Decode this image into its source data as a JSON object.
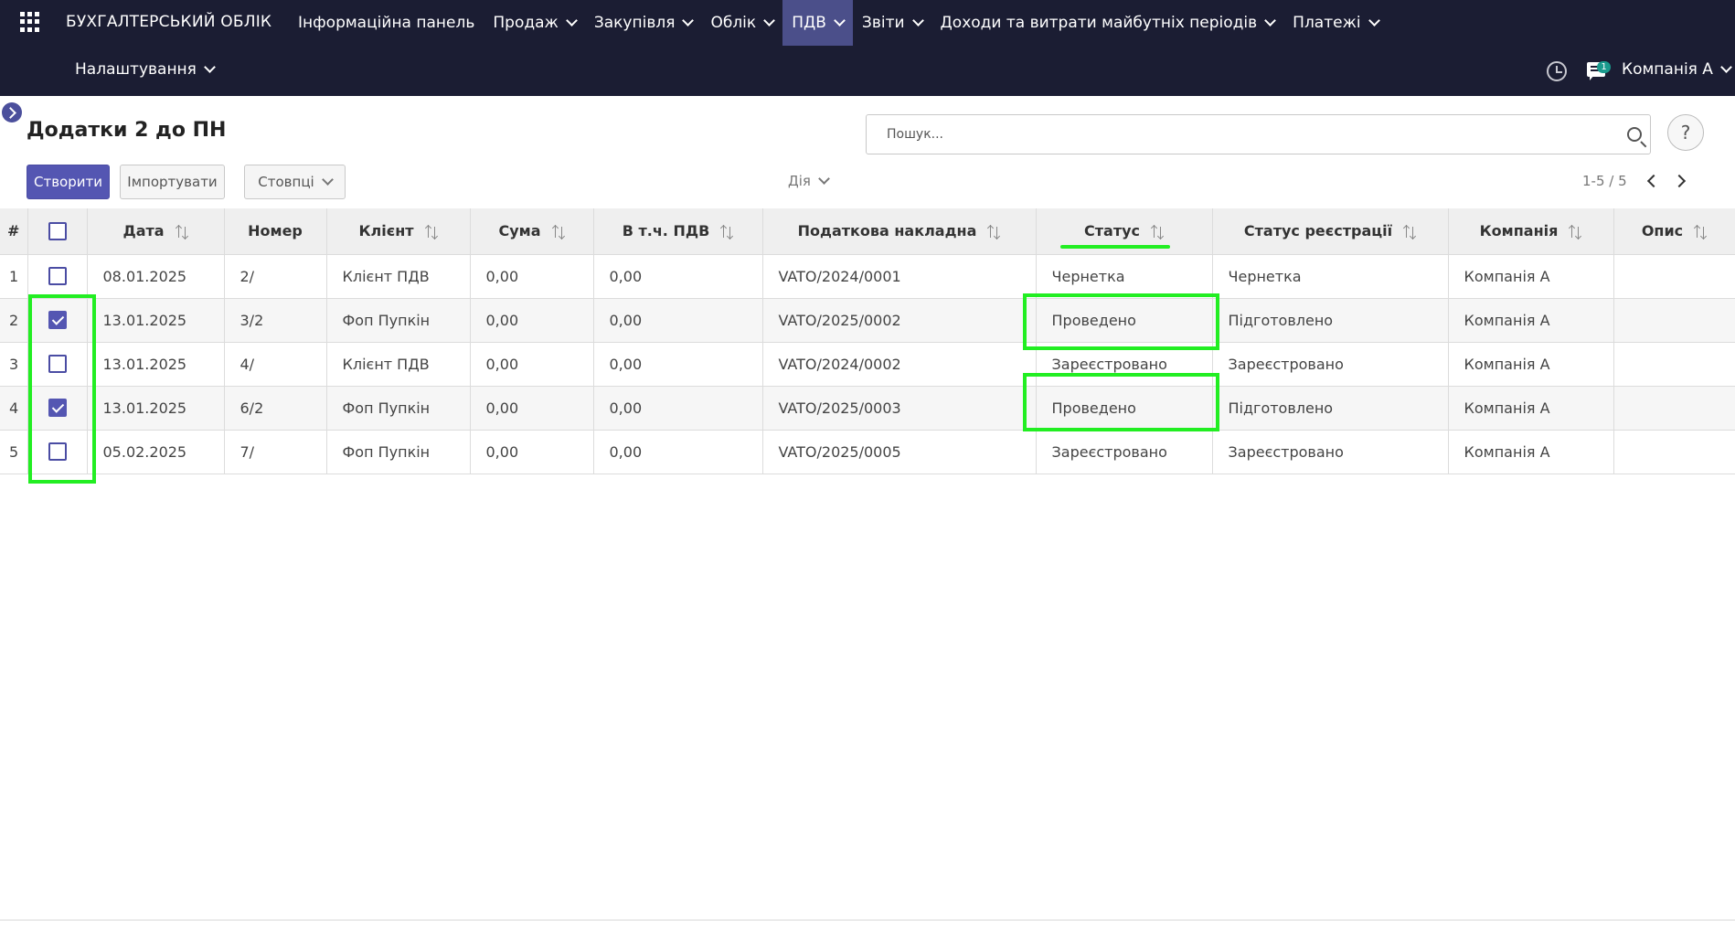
{
  "app": {
    "title": "БУХГАЛТЕРСЬКИЙ ОБЛІК"
  },
  "menu": [
    {
      "label": "Інформаційна панель",
      "dropdown": false,
      "active": false
    },
    {
      "label": "Продаж",
      "dropdown": true,
      "active": false
    },
    {
      "label": "Закупівля",
      "dropdown": true,
      "active": false
    },
    {
      "label": "Облік",
      "dropdown": true,
      "active": false
    },
    {
      "label": "ПДВ",
      "dropdown": true,
      "active": true
    },
    {
      "label": "Звіти",
      "dropdown": true,
      "active": false
    },
    {
      "label": "Доходи та витрати майбутніх періодів",
      "dropdown": true,
      "active": false
    },
    {
      "label": "Платежі",
      "dropdown": true,
      "active": false
    }
  ],
  "settings_menu": {
    "label": "Налаштування"
  },
  "systray": {
    "chat_badge": "1",
    "company": "Компанія А"
  },
  "page": {
    "title": "Додатки 2 до ПН"
  },
  "search": {
    "placeholder": "Пошук..."
  },
  "help": {
    "label": "?"
  },
  "buttons": {
    "create": "Створити",
    "import": "Імпортувати",
    "columns": "Стовпці",
    "action": "Дія"
  },
  "pager": {
    "text": "1-5 / 5"
  },
  "table": {
    "headers": {
      "num": "#",
      "date": "Дата",
      "number": "Номер",
      "client": "Клієнт",
      "sum": "Сума",
      "vat": "В т.ч. ПДВ",
      "invoice": "Податкова накладна",
      "status": "Статус",
      "reg_status": "Статус реєстрації",
      "company": "Компанія",
      "description": "Опис"
    },
    "rows": [
      {
        "num": "1",
        "checked": false,
        "date": "08.01.2025",
        "number": "2/",
        "client": "Клієнт ПДВ",
        "sum": "0,00",
        "vat": "0,00",
        "invoice": "VATO/2024/0001",
        "status": "Чернетка",
        "reg_status": "Чернетка",
        "company": "Компанія А",
        "description": ""
      },
      {
        "num": "2",
        "checked": true,
        "date": "13.01.2025",
        "number": "3/2",
        "client": "Фоп Пупкін",
        "sum": "0,00",
        "vat": "0,00",
        "invoice": "VATO/2025/0002",
        "status": "Проведено",
        "reg_status": "Підготовлено",
        "company": "Компанія А",
        "description": ""
      },
      {
        "num": "3",
        "checked": false,
        "date": "13.01.2025",
        "number": "4/",
        "client": "Клієнт ПДВ",
        "sum": "0,00",
        "vat": "0,00",
        "invoice": "VATO/2024/0002",
        "status": "Зареєстровано",
        "reg_status": "Зареєстровано",
        "company": "Компанія А",
        "description": ""
      },
      {
        "num": "4",
        "checked": true,
        "date": "13.01.2025",
        "number": "6/2",
        "client": "Фоп Пупкін",
        "sum": "0,00",
        "vat": "0,00",
        "invoice": "VATO/2025/0003",
        "status": "Проведено",
        "reg_status": "Підготовлено",
        "company": "Компанія А",
        "description": ""
      },
      {
        "num": "5",
        "checked": false,
        "date": "05.02.2025",
        "number": "7/",
        "client": "Фоп Пупкін",
        "sum": "0,00",
        "vat": "0,00",
        "invoice": "VATO/2025/0005",
        "status": "Зареєстровано",
        "reg_status": "Зареєстровано",
        "company": "Компанія А",
        "description": ""
      }
    ]
  },
  "colors": {
    "nav_bg": "#1b1d33",
    "accent": "#5456b2",
    "highlight": "#22ee22"
  }
}
